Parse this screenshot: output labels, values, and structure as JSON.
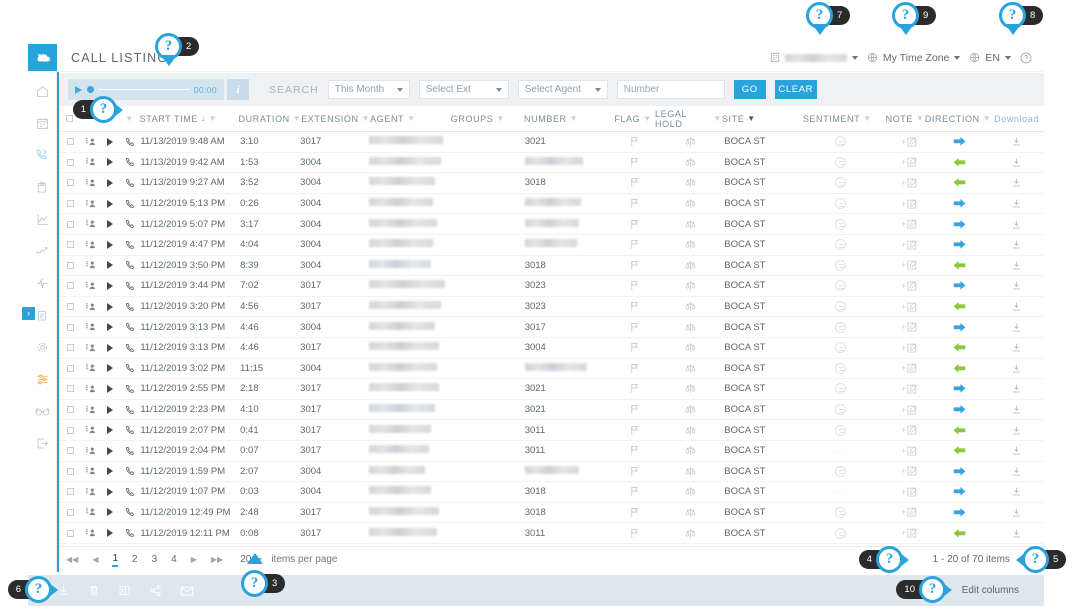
{
  "app": {
    "title": "CALL LISTING"
  },
  "header": {
    "org_value": "",
    "timezone_label": "My Time Zone",
    "language_label": "EN",
    "help_icon": "question-circle-icon",
    "building_icon": "building-icon",
    "globe_icon": "globe-icon"
  },
  "player": {
    "time": "00:00",
    "play_icon": "play-icon",
    "info_icon": "info-icon"
  },
  "search": {
    "label": "SEARCH",
    "period_value": "This Month",
    "extension_value": "Select Ext",
    "agent_value": "Select Agent",
    "number_placeholder": "Number",
    "number_value": "",
    "go_label": "GO",
    "clear_label": "CLEAR"
  },
  "table": {
    "columns": [
      "START TIME",
      "DURATION",
      "EXTENSION",
      "AGENT",
      "GROUPS",
      "NUMBER",
      "FLAG",
      "LEGAL HOLD",
      "SITE",
      "SENTIMENT",
      "NOTE",
      "DIRECTION",
      "Download"
    ],
    "sorted_column": "START TIME",
    "sort_direction": "desc",
    "rows": [
      {
        "start_time": "11/13/2019 9:48 AM",
        "duration": "3:10",
        "extension": "3017",
        "agent": "",
        "groups": "",
        "number": "3021",
        "site": "BOCA ST",
        "sentiment": "neutral",
        "direction": "out"
      },
      {
        "start_time": "11/13/2019 9:42 AM",
        "duration": "1:53",
        "extension": "3004",
        "agent": "",
        "groups": "",
        "number": "",
        "site": "BOCA ST",
        "sentiment": "neutral",
        "direction": "in"
      },
      {
        "start_time": "11/13/2019 9:27 AM",
        "duration": "3:52",
        "extension": "3004",
        "agent": "",
        "groups": "",
        "number": "3018",
        "site": "BOCA ST",
        "sentiment": "neutral",
        "direction": "in"
      },
      {
        "start_time": "11/12/2019 5:13 PM",
        "duration": "0:26",
        "extension": "3004",
        "agent": "",
        "groups": "",
        "number": "",
        "site": "BOCA ST",
        "sentiment": "neutral",
        "direction": "out"
      },
      {
        "start_time": "11/12/2019 5:07 PM",
        "duration": "3:17",
        "extension": "3004",
        "agent": "",
        "groups": "",
        "number": "",
        "site": "BOCA ST",
        "sentiment": "neutral",
        "direction": "out"
      },
      {
        "start_time": "11/12/2019 4:47 PM",
        "duration": "4:04",
        "extension": "3004",
        "agent": "",
        "groups": "",
        "number": "",
        "site": "BOCA ST",
        "sentiment": "neutral",
        "direction": "out"
      },
      {
        "start_time": "11/12/2019 3:50 PM",
        "duration": "8:39",
        "extension": "3004",
        "agent": "",
        "groups": "",
        "number": "3018",
        "site": "BOCA ST",
        "sentiment": "neutral",
        "direction": "in"
      },
      {
        "start_time": "11/12/2019 3:44 PM",
        "duration": "7:02",
        "extension": "3017",
        "agent": "",
        "groups": "",
        "number": "3023",
        "site": "BOCA ST",
        "sentiment": "neutral",
        "direction": "out"
      },
      {
        "start_time": "11/12/2019 3:20 PM",
        "duration": "4:56",
        "extension": "3017",
        "agent": "",
        "groups": "",
        "number": "3023",
        "site": "BOCA ST",
        "sentiment": "neutral",
        "direction": "in"
      },
      {
        "start_time": "11/12/2019 3:13 PM",
        "duration": "4:46",
        "extension": "3004",
        "agent": "",
        "groups": "",
        "number": "3017",
        "site": "BOCA ST",
        "sentiment": "neutral",
        "direction": "out"
      },
      {
        "start_time": "11/12/2019 3:13 PM",
        "duration": "4:46",
        "extension": "3017",
        "agent": "",
        "groups": "",
        "number": "3004",
        "site": "BOCA ST",
        "sentiment": "neutral",
        "direction": "in"
      },
      {
        "start_time": "11/12/2019 3:02 PM",
        "duration": "11:15",
        "extension": "3004",
        "agent": "",
        "groups": "",
        "number": "",
        "site": "BOCA ST",
        "sentiment": "neutral",
        "direction": "in"
      },
      {
        "start_time": "11/12/2019 2:55 PM",
        "duration": "2:18",
        "extension": "3017",
        "agent": "",
        "groups": "",
        "number": "3021",
        "site": "BOCA ST",
        "sentiment": "neutral",
        "direction": "out"
      },
      {
        "start_time": "11/12/2019 2:23 PM",
        "duration": "4:10",
        "extension": "3017",
        "agent": "",
        "groups": "",
        "number": "3021",
        "site": "BOCA ST",
        "sentiment": "neutral",
        "direction": "out"
      },
      {
        "start_time": "11/12/2019 2:07 PM",
        "duration": "0:41",
        "extension": "3017",
        "agent": "",
        "groups": "",
        "number": "3011",
        "site": "BOCA ST",
        "sentiment": "neutral",
        "direction": "in"
      },
      {
        "start_time": "11/12/2019 2:04 PM",
        "duration": "0:07",
        "extension": "3017",
        "agent": "",
        "groups": "",
        "number": "3011",
        "site": "BOCA ST",
        "sentiment": "none",
        "direction": "in"
      },
      {
        "start_time": "11/12/2019 1:59 PM",
        "duration": "2:07",
        "extension": "3004",
        "agent": "",
        "groups": "",
        "number": "",
        "site": "BOCA ST",
        "sentiment": "neutral",
        "direction": "out"
      },
      {
        "start_time": "11/12/2019 1:07 PM",
        "duration": "0:03",
        "extension": "3004",
        "agent": "",
        "groups": "",
        "number": "3018",
        "site": "BOCA ST",
        "sentiment": "none",
        "direction": "out"
      },
      {
        "start_time": "11/12/2019 12:49 PM",
        "duration": "2:48",
        "extension": "3017",
        "agent": "",
        "groups": "",
        "number": "3018",
        "site": "BOCA ST",
        "sentiment": "neutral",
        "direction": "out"
      },
      {
        "start_time": "11/12/2019 12:11 PM",
        "duration": "0:08",
        "extension": "3017",
        "agent": "",
        "groups": "",
        "number": "3011",
        "site": "BOCA ST",
        "sentiment": "neutral",
        "direction": "in"
      }
    ]
  },
  "pagination": {
    "first_icon": "first-page-icon",
    "prev_icon": "prev-page-icon",
    "pages": [
      "1",
      "2",
      "3",
      "4"
    ],
    "active_page": "1",
    "next_icon": "next-page-icon",
    "last_icon": "last-page-icon",
    "page_size": "20",
    "page_size_label": "items per page",
    "range_text": "1 - 20 of 70 items",
    "refresh_icon": "refresh-icon"
  },
  "actionbar": {
    "icons": [
      "download-icon",
      "trash-icon",
      "export-icon",
      "share-icon",
      "email-icon"
    ],
    "edit_columns_label": "Edit columns"
  },
  "sidebar": {
    "items": [
      {
        "name": "cloud-logo-icon",
        "label": ""
      },
      {
        "name": "home-icon",
        "label": ""
      },
      {
        "name": "calendar-icon",
        "label": ""
      },
      {
        "name": "phone-icon",
        "label": ""
      },
      {
        "name": "clipboard-icon",
        "label": ""
      },
      {
        "name": "chart-icon",
        "label": ""
      },
      {
        "name": "analytics-icon",
        "label": ""
      },
      {
        "name": "pulse-icon",
        "label": ""
      },
      {
        "name": "report-icon",
        "label": ""
      },
      {
        "name": "gear-icon",
        "label": ""
      },
      {
        "name": "sliders-icon",
        "label": ""
      },
      {
        "name": "glasses-icon",
        "label": ""
      },
      {
        "name": "logout-icon",
        "label": ""
      }
    ],
    "expand_icon": "chevron-right-icon"
  },
  "help_pins": [
    {
      "number": "1",
      "side": "left"
    },
    {
      "number": "2",
      "side": "right"
    },
    {
      "number": "3",
      "side": "right"
    },
    {
      "number": "4",
      "side": "left"
    },
    {
      "number": "5",
      "side": "right"
    },
    {
      "number": "6",
      "side": "left"
    },
    {
      "number": "7",
      "side": "right"
    },
    {
      "number": "8",
      "side": "right"
    },
    {
      "number": "9",
      "side": "right"
    },
    {
      "number": "10",
      "side": "left"
    }
  ],
  "colors": {
    "accent": "#29a3dc",
    "inbound": "#8cc63f",
    "outbound": "#39a3da",
    "toolbar_bg": "#eef2f5",
    "actionbar_bg": "#dfe7ee"
  }
}
